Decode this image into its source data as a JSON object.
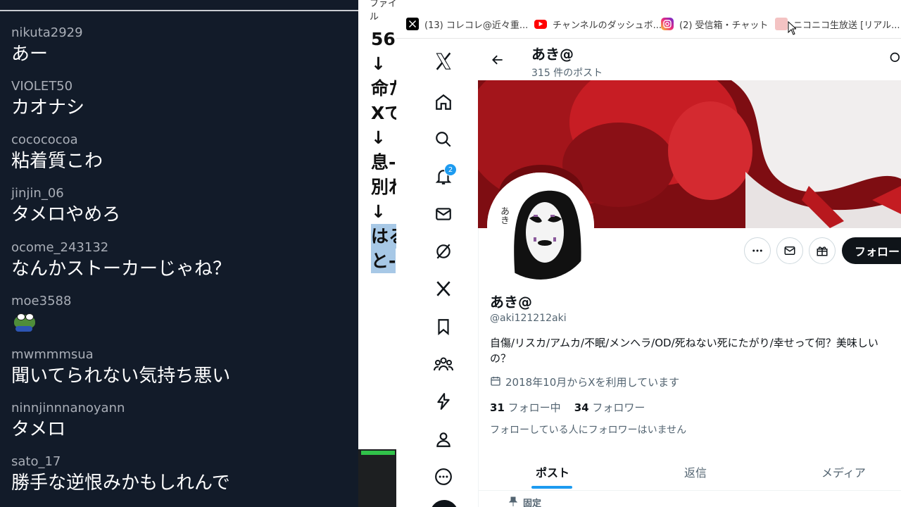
{
  "chat": {
    "messages": [
      {
        "user": "nikuta2929",
        "text": "あー"
      },
      {
        "user": "VIOLET50",
        "text": "カオナシ"
      },
      {
        "user": "cocococoa",
        "text": "粘着質こわ"
      },
      {
        "user": "jinjin_06",
        "text": "タメロやめろ"
      },
      {
        "user": "ocome_243132",
        "text": "なんかストーカーじゃね？"
      },
      {
        "user": "moe3588",
        "text": ""
      },
      {
        "user": "mwmmmsua",
        "text": "聞いてられない気持ち悪い"
      },
      {
        "user": "ninnjinnnanoyann",
        "text": "タメロ"
      },
      {
        "user": "sato_17",
        "text": "勝手な逆恨みかもしれんで"
      }
    ],
    "sticker_icon": "frog-sticker-icon"
  },
  "editor": {
    "menu": "ファイル",
    "lines": [
      "56",
      "↓",
      "命た",
      "Xで",
      "↓",
      "息-",
      "別れ",
      "↓"
    ],
    "selected_lines": [
      "はる",
      "と-"
    ]
  },
  "bookmarks": [
    {
      "icon": "x-logo-icon",
      "label": "(13) コレコレ@近々重..."
    },
    {
      "icon": "youtube-icon",
      "label": "チャンネルのダッシュボ..."
    },
    {
      "icon": "instagram-icon",
      "label": "(2) 受信箱・チャット"
    },
    {
      "icon": "niconico-icon",
      "label": "ニコニコ生放送 [リアル..."
    }
  ],
  "x_nav": {
    "notification_count": "2",
    "icons": [
      "x-logo-icon",
      "home-icon",
      "search-icon",
      "notifications-icon",
      "messages-icon",
      "grok-icon",
      "premium-x-icon",
      "bookmarks-icon",
      "communities-icon",
      "verified-orgs-icon",
      "profile-icon",
      "more-icon"
    ]
  },
  "profile": {
    "header_name": "あき@",
    "post_count": "315 件のポスト",
    "display_name": "あき@",
    "handle": "@aki121212aki",
    "bio": "自傷/リスカ/アムカ/不眠/メンヘラ/OD/死ねない死にたがり/幸せって何？美味しいの？",
    "joined": "2018年10月からXを利用しています",
    "following_count": "31",
    "following_label": "フォロー中",
    "followers_count": "34",
    "followers_label": "フォロワー",
    "known_followers": "フォローしている人にフォロワーはいません",
    "follow_button": "フォロー",
    "avatar_text": "あき",
    "tabs": [
      "ポスト",
      "返信",
      "メディア"
    ],
    "pinned_label": "固定"
  },
  "colors": {
    "chat_bg": "#121b29",
    "x_blue": "#1d9bf0",
    "banner_red": "#c0232a",
    "follow_btn": "#0f1419"
  }
}
